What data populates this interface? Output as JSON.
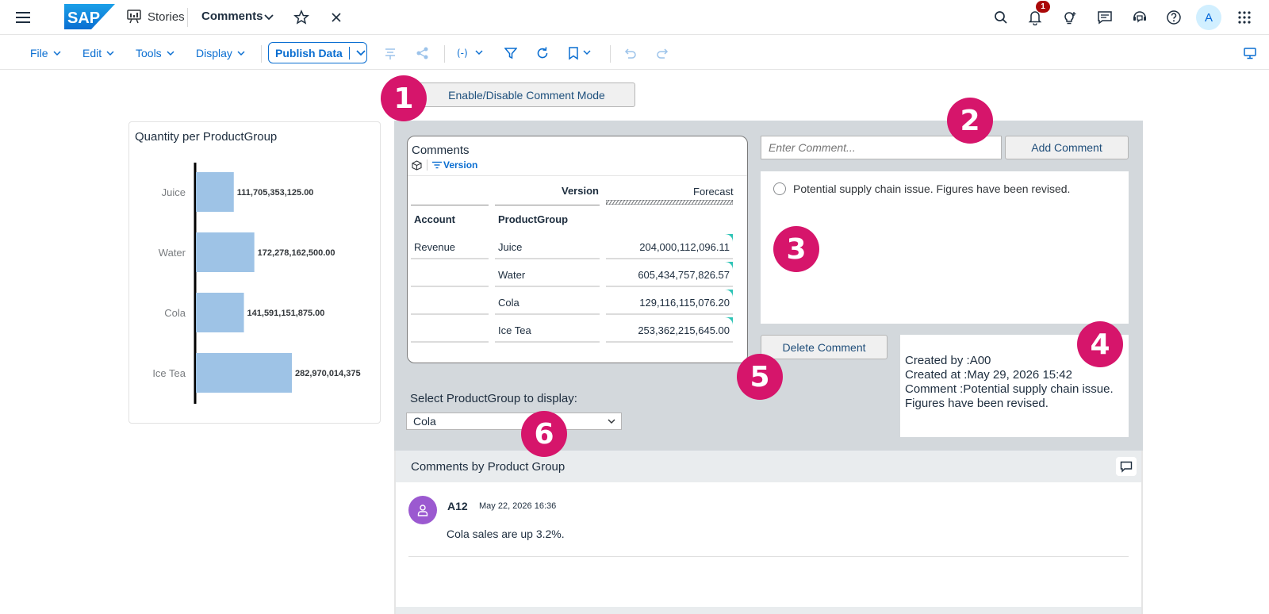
{
  "shell": {
    "logo_text": "SAP",
    "app_label": "Stories",
    "story_title": "Comments",
    "notification_count": "1",
    "avatar_initial": "A"
  },
  "toolbar": {
    "menus": [
      "File",
      "Edit",
      "Tools",
      "Display"
    ],
    "publish_label": "Publish Data"
  },
  "markers": [
    "1",
    "2",
    "3",
    "4",
    "5",
    "6"
  ],
  "comment_mode_button": "Enable/Disable Comment Mode",
  "chart": {
    "title": "Quantity per ProductGroup"
  },
  "chart_data": {
    "type": "bar",
    "orientation": "horizontal",
    "title": "Quantity per ProductGroup",
    "categories": [
      "Juice",
      "Water",
      "Cola",
      "Ice Tea"
    ],
    "values": [
      111705353125.0,
      172278162500.0,
      141591151875.0,
      282970014375
    ],
    "value_labels": [
      "111,705,353,125.00",
      "172,278,162,500.00",
      "141,591,151,875.00",
      "282,970,014,375"
    ],
    "bar_color": "#9ec3e6"
  },
  "table": {
    "title": "Comments",
    "filter_label": "Version",
    "col_version": "Version",
    "col_forecast": "Forecast",
    "col_account": "Account",
    "col_productgroup": "ProductGroup",
    "account_value": "Revenue",
    "rows": [
      {
        "group": "Juice",
        "value": "204,000,112,096.11"
      },
      {
        "group": "Water",
        "value": "605,434,757,826.57"
      },
      {
        "group": "Cola",
        "value": "129,116,115,076.20"
      },
      {
        "group": "Ice Tea",
        "value": "253,362,215,645.00"
      }
    ]
  },
  "comment_input": {
    "placeholder": "Enter Comment...",
    "add_label": "Add Comment"
  },
  "comment_list": {
    "item": "Potential supply chain issue. Figures have been revised."
  },
  "delete_label": "Delete Comment",
  "detail": {
    "created_by": "Created by :A00",
    "created_at": "Created at :May 29, 2026 15:42",
    "comment": "Comment :Potential supply chain issue. Figures have been revised."
  },
  "select": {
    "label": "Select ProductGroup to display:",
    "value": "Cola"
  },
  "comments_by_group": {
    "title": "Comments by Product Group",
    "user": "A12",
    "timestamp": "May 22, 2026 16:36",
    "text": "Cola sales are up 3.2%."
  },
  "colors": {
    "accent": "#0a6ed1",
    "marker": "#d6156b",
    "panel": "#d3d8dc",
    "comment_flag": "#2ec4b6"
  }
}
